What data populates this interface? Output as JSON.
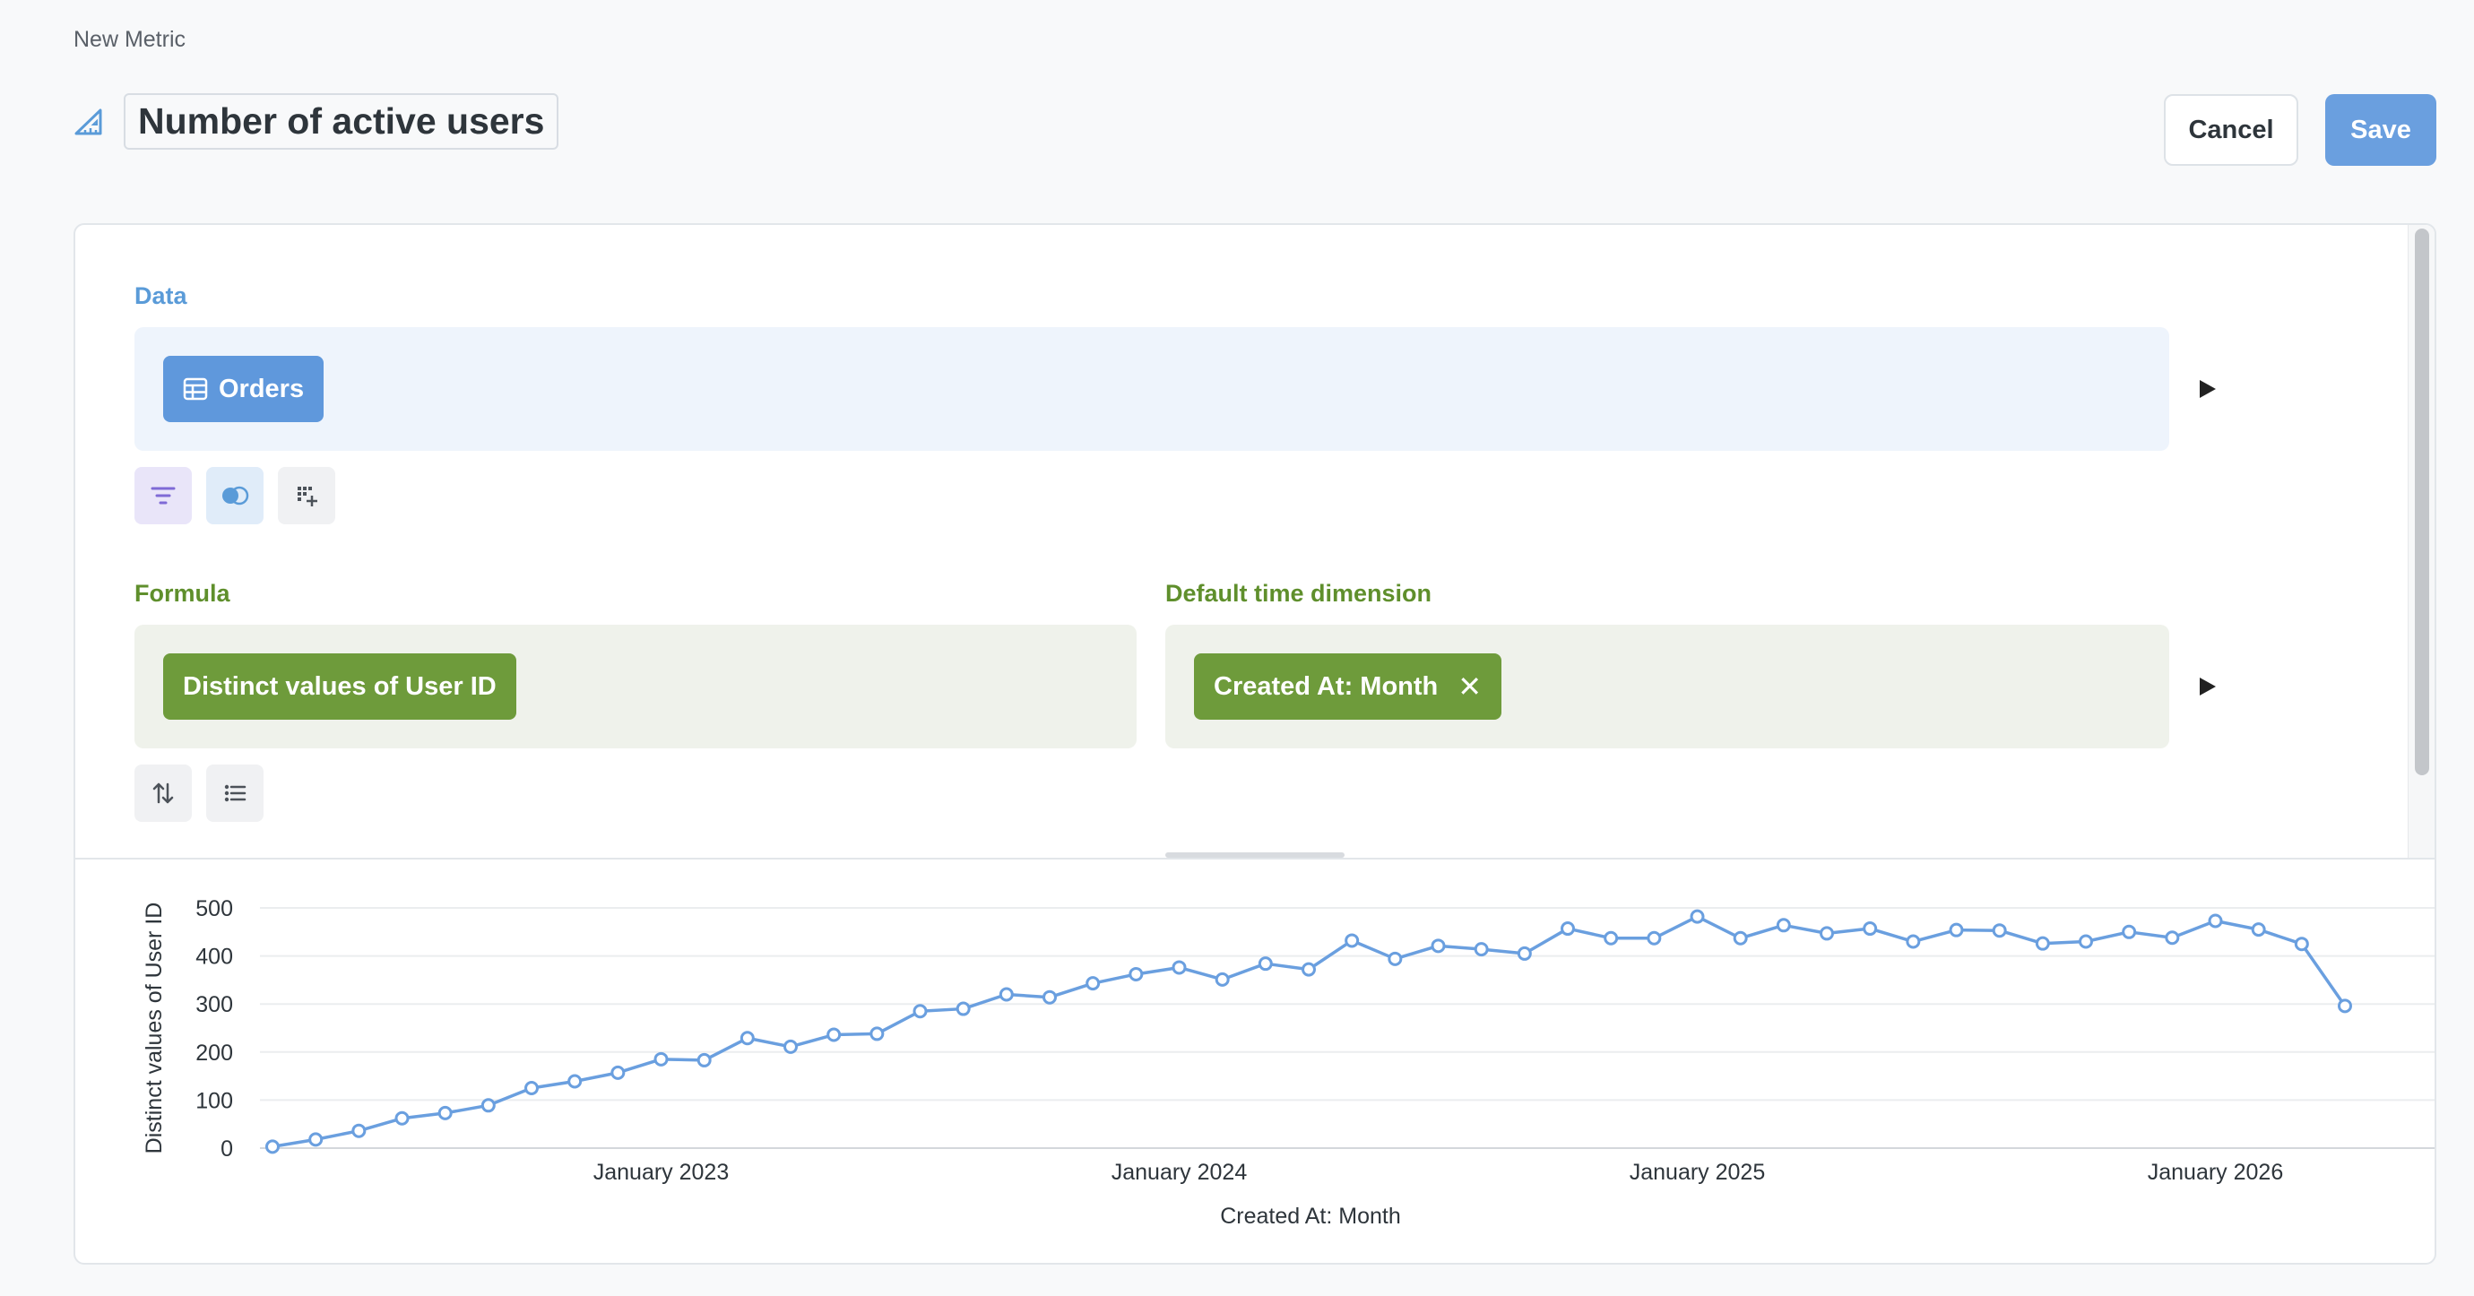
{
  "breadcrumb": "New Metric",
  "title": "Number of active users",
  "buttons": {
    "cancel": "Cancel",
    "save": "Save"
  },
  "data_section": {
    "label": "Data",
    "source": "Orders"
  },
  "formula_section": {
    "label": "Formula",
    "expression": "Distinct values of User ID"
  },
  "time_dimension_section": {
    "label": "Default time dimension",
    "value": "Created At: Month"
  },
  "icons": {
    "title": "metric-icon",
    "source": "table-icon",
    "filter": "filter-icon",
    "join": "join-icon",
    "custom_column": "custom-column-icon",
    "sort": "sort-icon",
    "limit": "list-icon",
    "run": "play-icon"
  },
  "colors": {
    "data_accent": "#5f98dc",
    "formula_accent": "#6e9b3b",
    "line": "#6a9fdf"
  },
  "chart_data": {
    "type": "line",
    "xlabel": "Created At: Month",
    "ylabel": "Distinct values of User ID",
    "ylim": [
      0,
      500
    ],
    "yticks": [
      0,
      100,
      200,
      300,
      400,
      500
    ],
    "x_tick_labels": [
      "January 2023",
      "January 2024",
      "January 2025",
      "January 2026"
    ],
    "x_start": "2022-04",
    "x_end": "2026-04",
    "grid": true,
    "series": [
      {
        "values": [
          3,
          18,
          36,
          62,
          73,
          89,
          125,
          139,
          157,
          185,
          183,
          229,
          211,
          236,
          238,
          285,
          290,
          320,
          314,
          343,
          362,
          376,
          351,
          384,
          372,
          432,
          394,
          421,
          414,
          405,
          457,
          437,
          437,
          482,
          437,
          464,
          447,
          457,
          430,
          454,
          453,
          426,
          430,
          450,
          438,
          473,
          455,
          425,
          296
        ]
      }
    ]
  }
}
